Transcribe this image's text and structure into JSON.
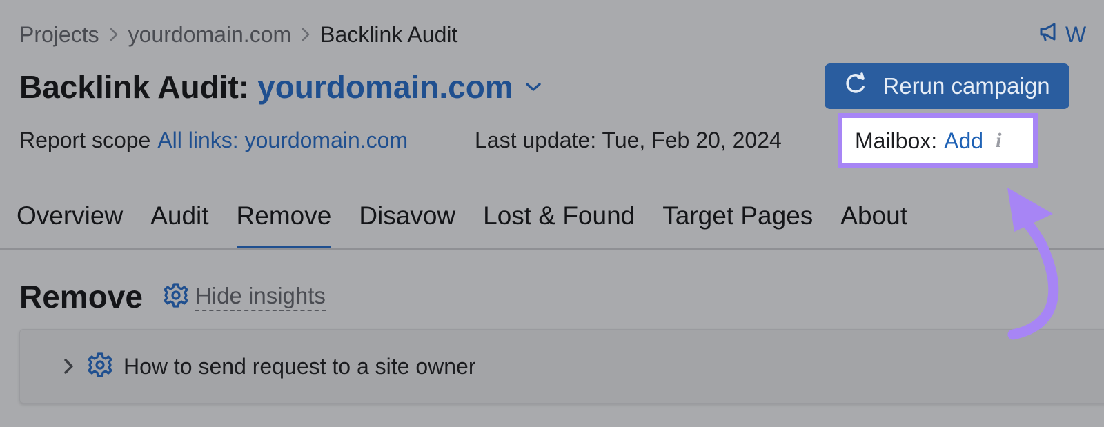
{
  "breadcrumb": {
    "items": [
      "Projects",
      "yourdomain.com",
      "Backlink Audit"
    ]
  },
  "announcement": {
    "label": "W"
  },
  "header": {
    "title_prefix": "Backlink Audit:",
    "domain": "yourdomain.com",
    "rerun_label": "Rerun campaign"
  },
  "meta": {
    "scope_label": "Report scope",
    "scope_value": "All links: yourdomain.com",
    "last_update": "Last update: Tue, Feb 20, 2024",
    "mailbox_label": "Mailbox:",
    "mailbox_action": "Add",
    "info_glyph": "i"
  },
  "tabs": [
    {
      "label": "Overview"
    },
    {
      "label": "Audit"
    },
    {
      "label": "Remove"
    },
    {
      "label": "Disavow"
    },
    {
      "label": "Lost & Found"
    },
    {
      "label": "Target Pages"
    },
    {
      "label": "About"
    }
  ],
  "section": {
    "title": "Remove",
    "hide_insights": "Hide insights",
    "insight_item": "How to send request to a site owner"
  },
  "colors": {
    "accent": "#1f4f8f",
    "link": "#1f62b5",
    "highlight": "#a785f5",
    "overlay_bg": "#a9aaad"
  },
  "icons": {
    "announce": "megaphone-icon",
    "rerun": "refresh-icon",
    "settings": "gear-icon",
    "expand": "chevron-right-icon",
    "dropdown": "chevron-down-icon"
  }
}
